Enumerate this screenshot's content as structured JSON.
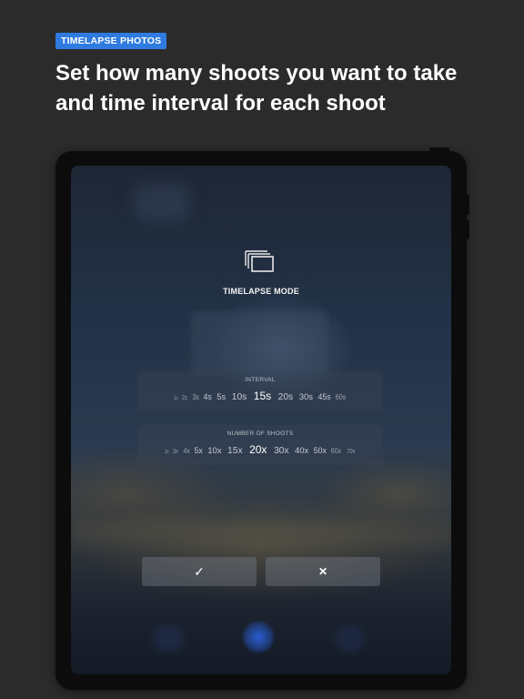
{
  "badge": "TIMELAPSE PHOTOS",
  "headline": "Set how many shoots you want to take and time interval for each shoot",
  "screen": {
    "mode_icon": "stacked-photos-icon",
    "mode_title": "TIMELAPSE MODE",
    "interval": {
      "label": "INTERVAL",
      "options": [
        "1s",
        "2s",
        "3s",
        "4s",
        "5s",
        "10s",
        "15s",
        "20s",
        "30s",
        "45s",
        "60s"
      ],
      "selected": "15s"
    },
    "shoots": {
      "label": "NUMBER OF SHOOTS",
      "options": [
        "2x",
        "3x",
        "4x",
        "5x",
        "10x",
        "15x",
        "20x",
        "30x",
        "40x",
        "50x",
        "60x",
        "70x"
      ],
      "selected": "20x"
    },
    "confirm_icon": "✓",
    "cancel_icon": "✕"
  },
  "colors": {
    "badge": "#2f7be0",
    "background": "#2b2b2b",
    "accent_dot": "#2a5fd6"
  }
}
